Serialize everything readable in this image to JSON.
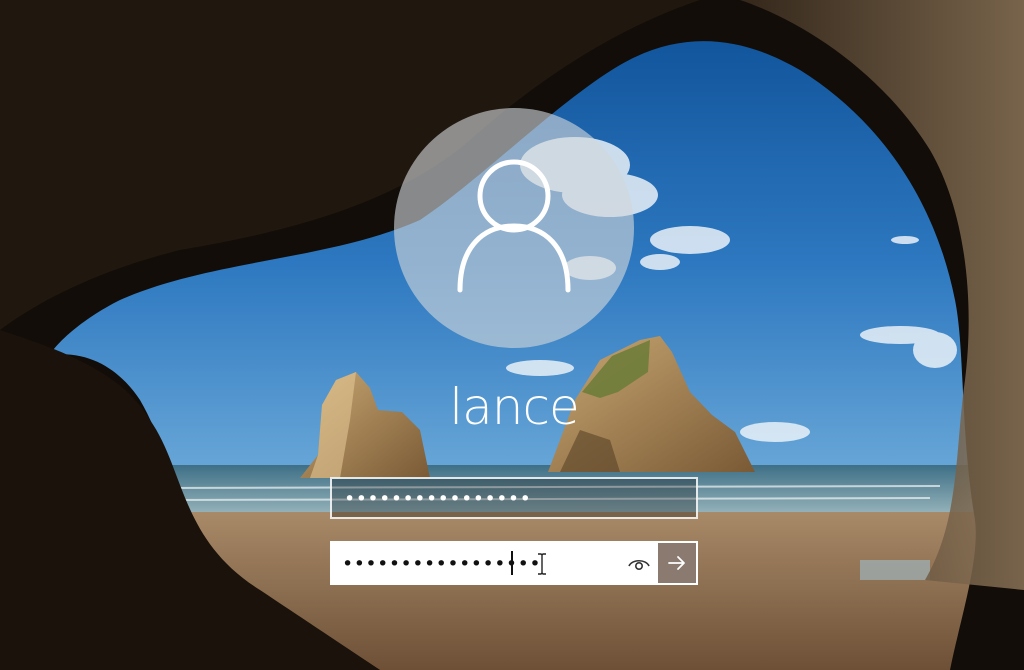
{
  "account": {
    "username": "lance"
  },
  "fields": {
    "first_masked_value": "••••••••••••••••",
    "password_masked_value": "•••••••••••••••••"
  },
  "icons": {
    "avatar": "user-silhouette-icon",
    "reveal": "eye-reveal-icon",
    "submit": "arrow-right-icon",
    "cursor": "text-ibeam-cursor-icon"
  },
  "colors": {
    "submit_button": "#8a7a70",
    "field_border": "#ffffff"
  }
}
